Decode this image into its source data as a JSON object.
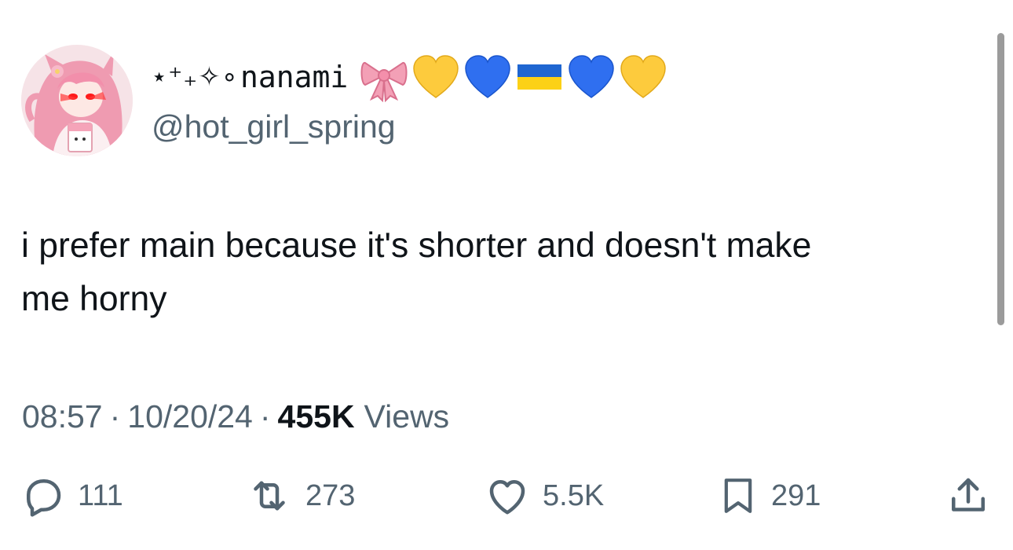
{
  "author": {
    "name_prefix": "⋆⁺₊✧∘",
    "name": "nanami",
    "emojis": [
      "ribbon-emoji",
      "yellow-heart-emoji",
      "blue-heart-emoji",
      "ukraine-flag-emoji",
      "blue-heart-emoji",
      "yellow-heart-emoji"
    ],
    "handle": "@hot_girl_spring"
  },
  "tweet": {
    "text": "i prefer main because it's shorter and doesn't make\nme horny"
  },
  "meta": {
    "time": "08:57",
    "separator": "·",
    "date": "10/20/24",
    "views_count": "455K",
    "views_label": "Views"
  },
  "actions": {
    "replies": "111",
    "retweets": "273",
    "likes": "5.5K",
    "bookmarks": "291"
  },
  "colors": {
    "text_primary": "#0f1419",
    "text_secondary": "#536471",
    "background": "#ffffff"
  }
}
